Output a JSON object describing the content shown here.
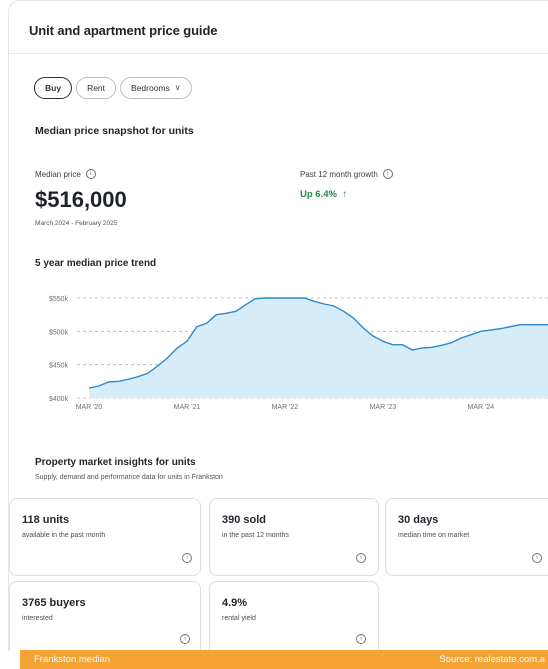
{
  "card": {
    "title": "Unit and apartment price guide"
  },
  "filters": [
    {
      "label": "Buy",
      "active": true
    },
    {
      "label": "Rent",
      "active": false
    },
    {
      "label": "Bedrooms",
      "active": false,
      "icon": "chevron-down-icon"
    }
  ],
  "snapshot": {
    "heading": "Median price snapshot for units",
    "median_label": "Median price",
    "median_value": "$516,000",
    "range": "March 2024 - February 2025",
    "growth_label": "Past 12 month growth",
    "growth_value": "Up 6.4%",
    "growth_arrow": "↑",
    "info_icon": "info-icon"
  },
  "trend": {
    "heading": "5 year median price trend",
    "line_color": "#2f88cc",
    "fill_color": "#d6ecf8"
  },
  "chart_data": {
    "type": "area",
    "title": "5 year median price trend",
    "x_ticks": [
      "MAR '20",
      "MAR '21",
      "MAR '22",
      "MAR '23",
      "MAR '24"
    ],
    "y_ticks": [
      "$550k",
      "$500k",
      "$450k",
      "$400k"
    ],
    "ylim": [
      400,
      550
    ],
    "grid": true,
    "x": [
      0,
      0.1,
      0.2,
      0.3,
      0.4,
      0.5,
      0.6,
      0.7,
      0.8,
      0.9,
      1.0,
      1.1,
      1.2,
      1.3,
      1.4,
      1.5,
      1.6,
      1.7,
      1.8,
      1.9,
      2.0,
      2.1,
      2.2,
      2.3,
      2.4,
      2.5,
      2.6,
      2.7,
      2.8,
      2.9,
      3.0,
      3.1,
      3.2,
      3.3,
      3.4,
      3.5,
      3.6,
      3.7,
      3.8,
      3.9,
      4.0,
      4.2,
      4.4,
      4.6,
      4.8,
      4.9
    ],
    "values": [
      415,
      418,
      424,
      425,
      428,
      432,
      437,
      448,
      460,
      475,
      485,
      507,
      512,
      525,
      527,
      530,
      540,
      549,
      550,
      550,
      550,
      550,
      550,
      545,
      541,
      538,
      530,
      520,
      505,
      493,
      485,
      480,
      480,
      472,
      475,
      476,
      479,
      483,
      490,
      495,
      500,
      504,
      510,
      510,
      510,
      512
    ]
  },
  "insights": {
    "heading": "Property market insights for units",
    "subheading": "Supply, demand and performance data for units in Frankston",
    "tiles": [
      {
        "main": "118 units",
        "sub": "available in the past month",
        "icon": "info-icon"
      },
      {
        "main": "390 sold",
        "sub": "in the past 12 months",
        "icon": "info-icon"
      },
      {
        "main": "30 days",
        "sub": "median time on market",
        "icon": "info-icon"
      },
      {
        "main": "3765 buyers",
        "sub": "interested",
        "icon": "info-icon"
      },
      {
        "main": "4.9%",
        "sub": "rental yield",
        "icon": "info-icon"
      }
    ]
  },
  "footer": {
    "left": "Frankston median",
    "right": "Source: realestate.com.a"
  }
}
